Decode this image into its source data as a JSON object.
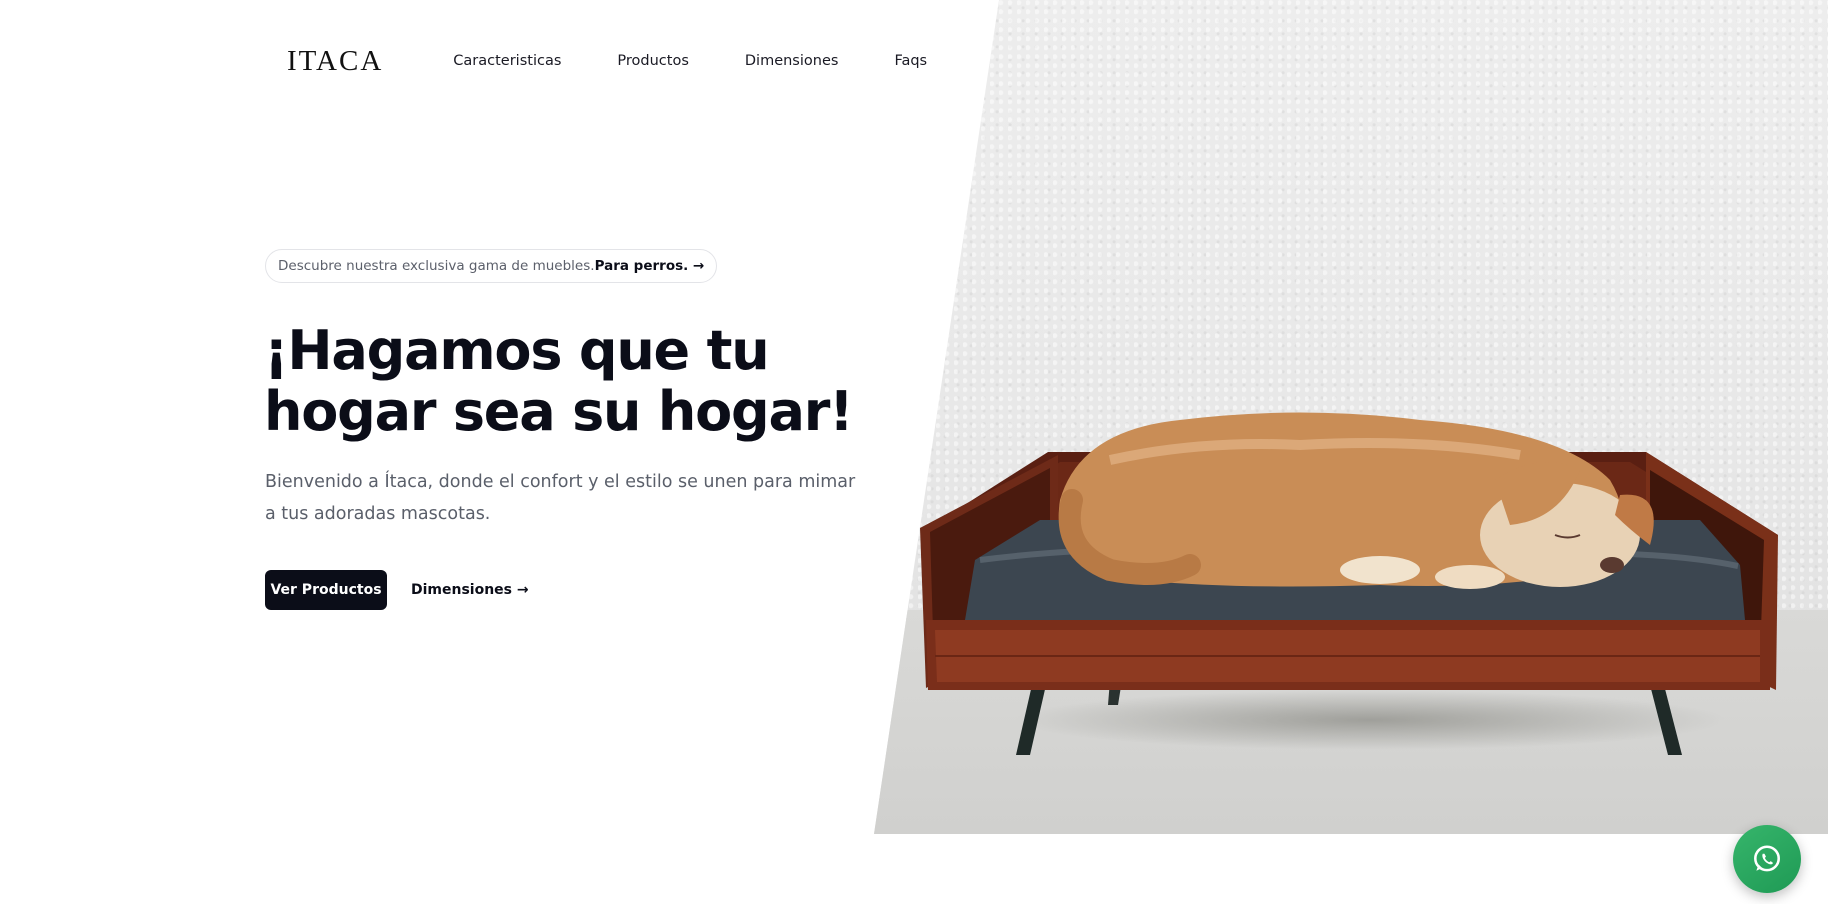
{
  "brand": {
    "logo_text": "ITACA"
  },
  "nav": {
    "items": [
      {
        "label": "Caracteristicas"
      },
      {
        "label": "Productos"
      },
      {
        "label": "Dimensiones"
      },
      {
        "label": "Faqs"
      }
    ]
  },
  "hero": {
    "pill_text": "Descubre nuestra exclusiva gama de muebles.",
    "pill_link": "Para perros. →",
    "title_line1": "¡Hagamos que tu",
    "title_line2": "hogar sea su hogar!",
    "subtitle": "Bienvenido a Ítaca, donde el confort y el estilo se unen para mimar a tus adoradas mascotas.",
    "primary_button": "Ver Productos",
    "secondary_link": "Dimensiones →"
  },
  "floating": {
    "icon": "whatsapp-icon"
  },
  "colors": {
    "primary": "#0b0d18",
    "muted_text": "#5a5f6a",
    "whatsapp_green": "#25a35a",
    "bed_wood": "#7a2e1a",
    "cushion": "#3c4650"
  }
}
